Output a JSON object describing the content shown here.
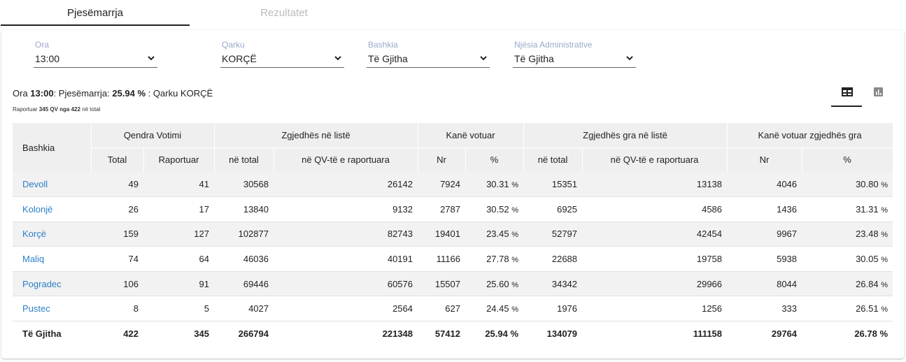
{
  "tabs": [
    {
      "label": "Pjesëmarrja"
    },
    {
      "label": "Rezultatet"
    }
  ],
  "filters": [
    {
      "label": "Ora",
      "value": "13:00"
    },
    {
      "label": "Qarku",
      "value": "KORÇË"
    },
    {
      "label": "Bashkia",
      "value": "Të Gjitha"
    },
    {
      "label": "Njësia Administrative",
      "value": "Të Gjitha"
    }
  ],
  "summary": {
    "p1": "Ora ",
    "ora": "13:00",
    "p2": ": Pjesëmarrja: ",
    "pct": "25.94 %",
    "p3": " : Qarku KORÇË"
  },
  "subsummary": {
    "p1": "Raportuar ",
    "bold": "345 QV nga 422",
    "p2": " në total"
  },
  "view_toggle": {
    "table_icon": "table-view-icon",
    "chart_icon": "bar-chart-icon"
  },
  "table": {
    "header_groups": [
      "Bashkia",
      "Qendra Votimi",
      "Zgjedhës në listë",
      "Kanë votuar",
      "Zgjedhës gra në listë",
      "Kanë votuar zgjedhës gra"
    ],
    "subheaders": [
      "Total",
      "Raportuar",
      "në total",
      "në QV-të e raportuara",
      "Nr",
      "%",
      "në total",
      "në QV-të e raportuara",
      "Nr",
      "%"
    ],
    "rows": [
      {
        "name": "Devoll",
        "c1": "49",
        "c2": "41",
        "c3": "30568",
        "c4": "26142",
        "c5": "7924",
        "c6": "30.31",
        "c7": "15351",
        "c8": "13138",
        "c9": "4046",
        "c10": "30.80"
      },
      {
        "name": "Kolonjë",
        "c1": "26",
        "c2": "17",
        "c3": "13840",
        "c4": "9132",
        "c5": "2787",
        "c6": "30.52",
        "c7": "6925",
        "c8": "4586",
        "c9": "1436",
        "c10": "31.31"
      },
      {
        "name": "Korçë",
        "c1": "159",
        "c2": "127",
        "c3": "102877",
        "c4": "82743",
        "c5": "19401",
        "c6": "23.45",
        "c7": "52797",
        "c8": "42454",
        "c9": "9967",
        "c10": "23.48"
      },
      {
        "name": "Maliq",
        "c1": "74",
        "c2": "64",
        "c3": "46036",
        "c4": "40191",
        "c5": "11166",
        "c6": "27.78",
        "c7": "22688",
        "c8": "19758",
        "c9": "5938",
        "c10": "30.05"
      },
      {
        "name": "Pogradec",
        "c1": "106",
        "c2": "91",
        "c3": "69446",
        "c4": "60576",
        "c5": "15507",
        "c6": "25.60",
        "c7": "34342",
        "c8": "29966",
        "c9": "8044",
        "c10": "26.84"
      },
      {
        "name": "Pustec",
        "c1": "8",
        "c2": "5",
        "c3": "4027",
        "c4": "2564",
        "c5": "627",
        "c6": "24.45",
        "c7": "1976",
        "c8": "1256",
        "c9": "333",
        "c10": "26.51"
      }
    ],
    "total": {
      "name": "Të Gjitha",
      "c1": "422",
      "c2": "345",
      "c3": "266794",
      "c4": "221348",
      "c5": "57412",
      "c6": "25.94 %",
      "c7": "134079",
      "c8": "111158",
      "c9": "29764",
      "c10": "26.78 %"
    },
    "pct_sign": "%"
  }
}
